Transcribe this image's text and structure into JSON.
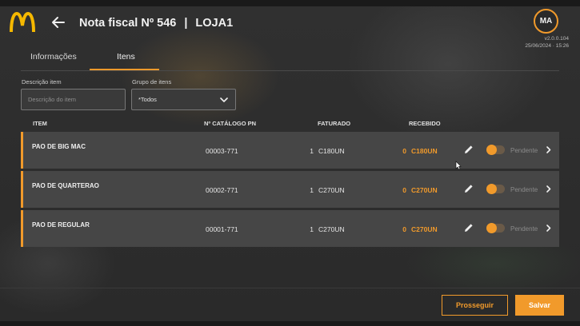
{
  "header": {
    "title": "Nota fiscal Nº 546",
    "separator": "|",
    "store": "LOJA1",
    "avatar_initials": "MA",
    "version": "v2.0.0.104",
    "datetime": "25/06/2024 · 15:26"
  },
  "tabs": [
    {
      "label": "Informações",
      "active": false
    },
    {
      "label": "Itens",
      "active": true
    }
  ],
  "filters": {
    "description_label": "Descrição item",
    "description_placeholder": "Descrição do item",
    "group_label": "Grupo de itens",
    "group_value": "*Todos"
  },
  "table": {
    "headers": {
      "item": "ITEM",
      "catalog": "Nº CATÁLOGO PN",
      "billed": "FATURADO",
      "received": "RECEBIDO"
    },
    "rows": [
      {
        "name": "PAO DE BIG MAC",
        "catalog": "00003-771",
        "billed_qty": "1",
        "billed_unit": "C180UN",
        "received_qty": "0",
        "received_unit": "C180UN",
        "status": "Pendente"
      },
      {
        "name": "PAO DE QUARTERAO",
        "catalog": "00002-771",
        "billed_qty": "1",
        "billed_unit": "C270UN",
        "received_qty": "0",
        "received_unit": "C270UN",
        "status": "Pendente"
      },
      {
        "name": "PAO DE REGULAR",
        "catalog": "00001-771",
        "billed_qty": "1",
        "billed_unit": "C270UN",
        "received_qty": "0",
        "received_unit": "C270UN",
        "status": "Pendente"
      }
    ]
  },
  "footer": {
    "proceed_label": "Prosseguir",
    "save_label": "Salvar"
  },
  "colors": {
    "accent": "#f19a2b",
    "logo_yellow": "#f5b800",
    "row_background": "#464646"
  },
  "icons": [
    "mcdonalds-logo",
    "arrow-left-icon",
    "chevron-down-icon",
    "pencil-icon",
    "chevron-right-icon"
  ]
}
